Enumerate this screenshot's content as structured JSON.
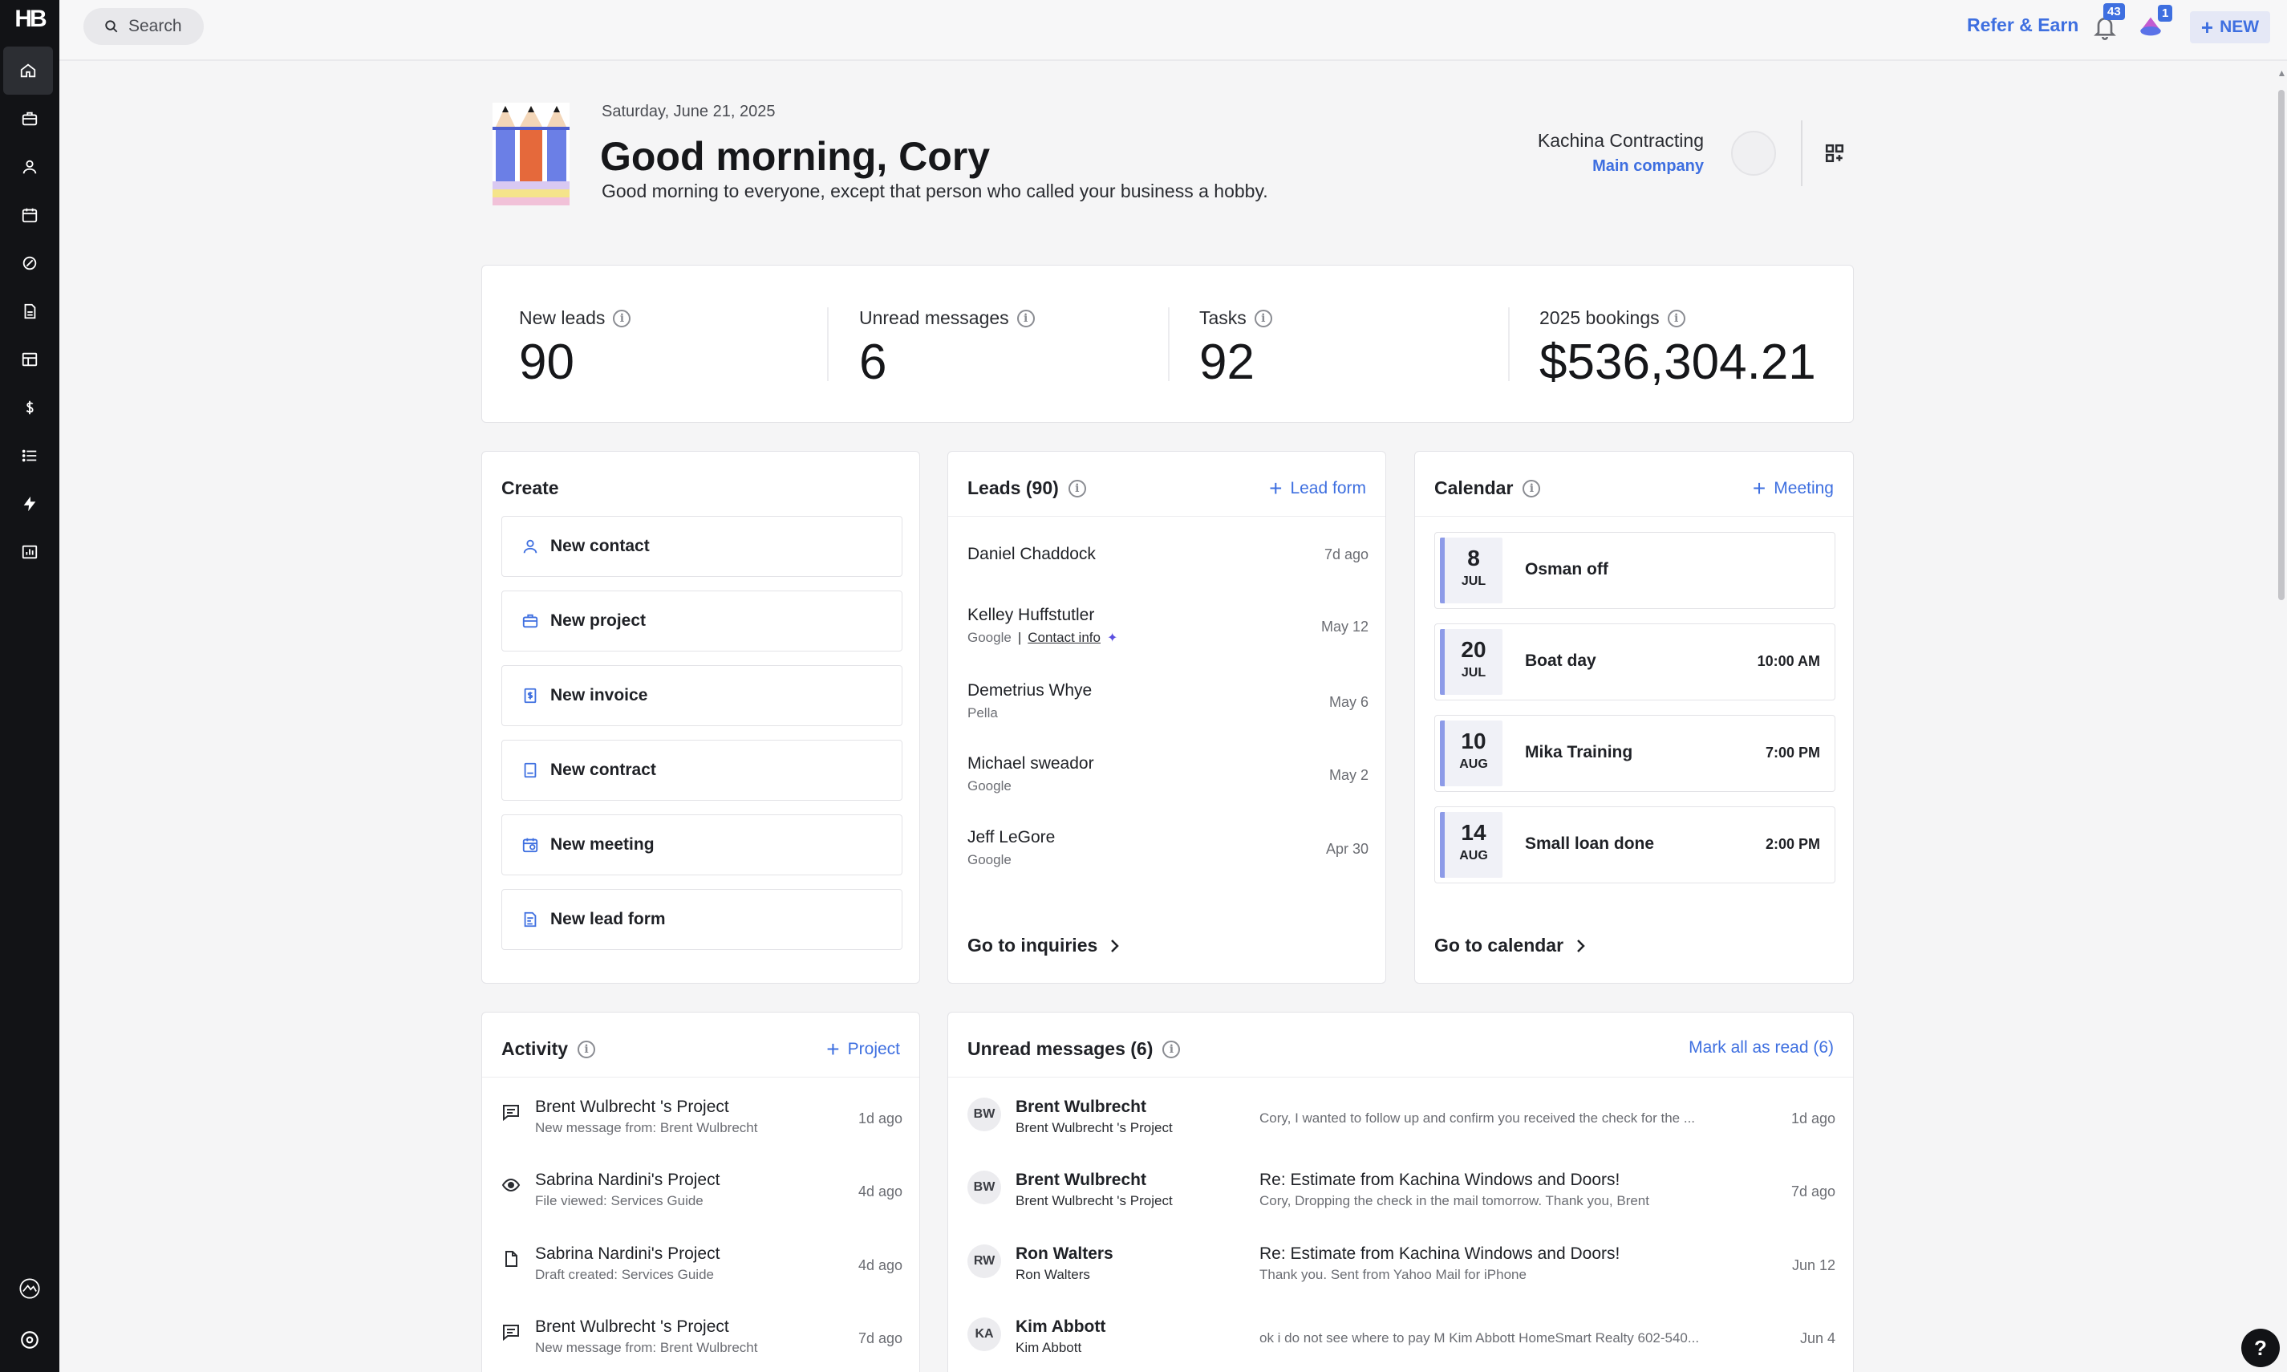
{
  "app": {
    "logo": "HB"
  },
  "sidebar": {
    "items": [
      {
        "icon": "home-icon"
      },
      {
        "icon": "briefcase-icon"
      },
      {
        "icon": "person-icon"
      },
      {
        "icon": "calendar-icon"
      },
      {
        "icon": "pen-icon"
      },
      {
        "icon": "document-icon"
      },
      {
        "icon": "layout-icon"
      },
      {
        "icon": "dollar-icon"
      },
      {
        "icon": "list-icon"
      },
      {
        "icon": "lightning-icon"
      },
      {
        "icon": "bar-chart-icon"
      }
    ],
    "bottom": [
      {
        "icon": "company-logo-icon"
      },
      {
        "icon": "settings-icon"
      }
    ]
  },
  "topbar": {
    "search_placeholder": "Search",
    "refer_label": "Refer & Earn",
    "notifications_count": "43",
    "gifts_count": "1",
    "new_label": "NEW"
  },
  "header": {
    "date": "Saturday, June 21, 2025",
    "greeting": "Good morning, Cory",
    "tagline": "Good morning to everyone, except that person who called your business a hobby.",
    "company_name": "Kachina Contracting",
    "company_sub": "Main company"
  },
  "stats": [
    {
      "label": "New leads",
      "value": "90"
    },
    {
      "label": "Unread messages",
      "value": "6"
    },
    {
      "label": "Tasks",
      "value": "92"
    },
    {
      "label": "2025 bookings",
      "value": "$536,304.21"
    }
  ],
  "create": {
    "title": "Create",
    "items": [
      {
        "label": "New contact",
        "icon": "person-icon"
      },
      {
        "label": "New project",
        "icon": "briefcase-icon"
      },
      {
        "label": "New invoice",
        "icon": "invoice-icon"
      },
      {
        "label": "New contract",
        "icon": "contract-icon"
      },
      {
        "label": "New meeting",
        "icon": "calendar-icon"
      },
      {
        "label": "New lead form",
        "icon": "form-icon"
      }
    ]
  },
  "leads": {
    "title": "Leads (90)",
    "action": "Lead form",
    "items": [
      {
        "name": "Daniel Chaddock",
        "source": "",
        "time": "7d ago"
      },
      {
        "name": "Kelley Huffstutler",
        "source": "Google",
        "contact_link": "Contact info",
        "time": "May 12"
      },
      {
        "name": "Demetrius Whye",
        "source": "Pella",
        "time": "May 6"
      },
      {
        "name": "Michael sweador",
        "source": "Google",
        "time": "May 2"
      },
      {
        "name": "Jeff LeGore",
        "source": "Google",
        "time": "Apr 30"
      }
    ],
    "footer": "Go to inquiries"
  },
  "calendar": {
    "title": "Calendar",
    "action": "Meeting",
    "events": [
      {
        "day": "8",
        "month": "JUL",
        "title": "Osman off",
        "time": ""
      },
      {
        "day": "20",
        "month": "JUL",
        "title": "Boat day",
        "time": "10:00 AM"
      },
      {
        "day": "10",
        "month": "AUG",
        "title": "Mika Training",
        "time": "7:00 PM"
      },
      {
        "day": "14",
        "month": "AUG",
        "title": "Small loan done",
        "time": "2:00 PM"
      }
    ],
    "footer": "Go to calendar"
  },
  "activity": {
    "title": "Activity",
    "action": "Project",
    "items": [
      {
        "icon": "message-icon",
        "title": "Brent Wulbrecht 's Project",
        "sub": "New message from: Brent Wulbrecht",
        "time": "1d ago"
      },
      {
        "icon": "eye-icon",
        "title": "Sabrina Nardini's Project",
        "sub": "File viewed: Services Guide",
        "time": "4d ago"
      },
      {
        "icon": "file-icon",
        "title": "Sabrina Nardini's Project",
        "sub": "Draft created: Services Guide",
        "time": "4d ago"
      },
      {
        "icon": "message-icon",
        "title": "Brent Wulbrecht 's Project",
        "sub": "New message from: Brent Wulbrecht",
        "time": "7d ago"
      }
    ]
  },
  "messages": {
    "title": "Unread messages (6)",
    "action": "Mark all as read (6)",
    "items": [
      {
        "initials": "BW",
        "name": "Brent Wulbrecht",
        "project": "Brent Wulbrecht 's Project",
        "subject": "",
        "preview": "Cory, I wanted to follow up and confirm you received the check for the ...",
        "time": "1d ago"
      },
      {
        "initials": "BW",
        "name": "Brent Wulbrecht",
        "project": "Brent Wulbrecht 's Project",
        "subject": "Re: Estimate from Kachina Windows and Doors!",
        "preview": "Cory, Dropping the check in the mail tomorrow. Thank you, Brent",
        "time": "7d ago"
      },
      {
        "initials": "RW",
        "name": "Ron Walters",
        "project": "Ron Walters",
        "subject": "Re: Estimate from Kachina Windows and Doors!",
        "preview": "Thank you. Sent from Yahoo Mail for iPhone",
        "time": "Jun 12"
      },
      {
        "initials": "KA",
        "name": "Kim Abbott",
        "project": "Kim Abbott",
        "subject": "",
        "preview": "ok i do not see where to pay M Kim Abbott HomeSmart Realty 602-540...",
        "time": "Jun 4"
      }
    ]
  },
  "help_label": "?"
}
